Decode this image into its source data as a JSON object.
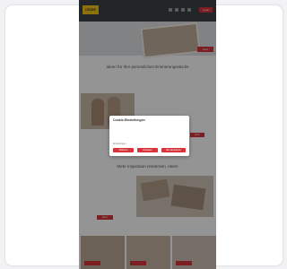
{
  "site": {
    "logo_text": "CEWE",
    "header_cta": "Login",
    "nav_icons": [
      "search-icon",
      "heart-icon",
      "user-icon",
      "cart-icon"
    ]
  },
  "hero": {
    "text": "",
    "button": "Jetzt"
  },
  "section1": {
    "title": "Ideen für Ihre persönlichen Erinnerungsstücke",
    "subtitle": ""
  },
  "feature1": {
    "text": "",
    "button": "Mehr"
  },
  "section2": {
    "title": "Mehr Inspiration entdecken, Ideen"
  },
  "feature2": {
    "text": "",
    "button": "Mehr"
  },
  "cookie_dialog": {
    "title": "Cookie-Einstellungen",
    "body": "",
    "settings_link": "Einstellungen",
    "buttons": [
      "Ablehnen",
      "Anpassen",
      "Alle akzeptieren"
    ]
  },
  "colors": {
    "accent": "#d8343b",
    "header": "#3d4347",
    "logo": "#f0c419"
  }
}
